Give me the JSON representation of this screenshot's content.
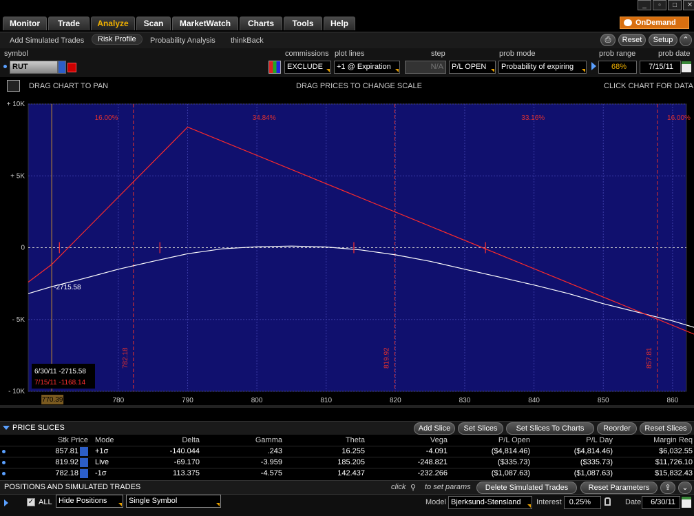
{
  "nav": {
    "tabs": [
      "Monitor",
      "Trade",
      "Analyze",
      "Scan",
      "MarketWatch",
      "Charts",
      "Tools",
      "Help"
    ],
    "active_tab": "Analyze",
    "ondemand_label": "OnDemand"
  },
  "subnav": {
    "items": [
      "Add Simulated Trades",
      "Risk Profile",
      "Probability Analysis",
      "thinkBack"
    ],
    "active": "Risk Profile",
    "reset_label": "Reset",
    "setup_label": "Setup"
  },
  "params": {
    "symbol_label": "symbol",
    "symbol_value": "RUT",
    "commissions_label": "commissions",
    "commissions_value": "EXCLUDE",
    "plotlines_label": "plot lines",
    "plotlines_value": "+1 @ Expiration",
    "step_label": "step",
    "step_value": "N/A",
    "pl_value": "P/L OPEN",
    "probmode_label": "prob mode",
    "probmode_value": "Probability of expiring",
    "probrange_label": "prob range",
    "probrange_value": "68%",
    "probdate_label": "prob date",
    "probdate_value": "7/15/11"
  },
  "chart_header": {
    "left": "DRAG CHART TO PAN",
    "center": "DRAG PRICES TO CHANGE SCALE",
    "right": "CLICK CHART FOR DATA"
  },
  "chart_data": {
    "type": "line",
    "xlim": [
      767,
      862
    ],
    "ylim": [
      -10000,
      10000
    ],
    "x_ticks": [
      780,
      790,
      800,
      810,
      820,
      830,
      840,
      850,
      860
    ],
    "y_ticks": [
      {
        "value": 10000,
        "label": "+ 10K"
      },
      {
        "value": 5000,
        "label": "+ 5K"
      },
      {
        "value": 0,
        "label": "0"
      },
      {
        "value": -5000,
        "label": "- 5K"
      },
      {
        "value": -10000,
        "label": "- 10K"
      }
    ],
    "current_price_label": "770.39",
    "current_price": 770.39,
    "grid": true,
    "series": [
      {
        "name": "6/30/11",
        "color": "#ffffff",
        "points": [
          [
            767,
            -3200
          ],
          [
            770.39,
            -2715.58
          ],
          [
            775,
            -2150
          ],
          [
            780,
            -1500
          ],
          [
            785,
            -950
          ],
          [
            790,
            -420
          ],
          [
            795,
            -80
          ],
          [
            800,
            60
          ],
          [
            805,
            110
          ],
          [
            810,
            50
          ],
          [
            815,
            -160
          ],
          [
            820,
            -500
          ],
          [
            825,
            -950
          ],
          [
            830,
            -1500
          ],
          [
            835,
            -2050
          ],
          [
            840,
            -2600
          ],
          [
            845,
            -3200
          ],
          [
            850,
            -3900
          ],
          [
            855,
            -4500
          ],
          [
            860,
            -5100
          ],
          [
            863.5,
            -5600
          ]
        ]
      },
      {
        "name": "7/15/11",
        "color": "#ff2a2a",
        "points": [
          [
            767,
            -2400
          ],
          [
            770.39,
            -1168.14
          ],
          [
            790,
            8400
          ],
          [
            863.5,
            -6100
          ]
        ]
      }
    ],
    "slice_lines": [
      782.18,
      819.92,
      857.81
    ],
    "slice_labels": [
      "782.18",
      "819.92",
      "857.81"
    ],
    "breakeven_markers": [
      [
        771.5,
        0
      ],
      [
        786,
        0
      ],
      [
        814,
        0
      ],
      [
        833,
        0
      ]
    ],
    "region_labels": [
      "16.00%",
      "34.84%",
      "33.16%",
      "16.00%"
    ],
    "annotation": "-2715.58",
    "readout": [
      {
        "date": "6/30/11",
        "value": "-2715.58",
        "color": "#ffffff"
      },
      {
        "date": "7/15/11",
        "value": "-1168.14",
        "color": "#ff3030"
      }
    ]
  },
  "price_slices": {
    "title": "PRICE SLICES",
    "buttons": [
      "Add Slice",
      "Set Slices",
      "Set Slices To Charts",
      "Reorder",
      "Reset Slices"
    ],
    "columns": [
      "Stk Price",
      "Mode",
      "Delta",
      "Gamma",
      "Theta",
      "Vega",
      "P/L Open",
      "P/L Day",
      "Margin Req"
    ],
    "rows": [
      [
        "857.81",
        "+1σ",
        "-140.044",
        ".243",
        "16.255",
        "-4.091",
        "($4,814.46)",
        "($4,814.46)",
        "$6,032.55"
      ],
      [
        "819.92",
        "Live",
        "-69.170",
        "-3.959",
        "185.205",
        "-248.821",
        "($335.73)",
        "($335.73)",
        "$11,726.10"
      ],
      [
        "782.18",
        "-1σ",
        "113.375",
        "-4.575",
        "142.437",
        "-232.266",
        "($1,087.63)",
        "($1,087.63)",
        "$15,832.43"
      ]
    ]
  },
  "positions": {
    "title": "POSITIONS AND SIMULATED TRADES",
    "click_text": "click",
    "set_params_text": "to set params",
    "delete_label": "Delete Simulated Trades",
    "reset_params_label": "Reset Parameters"
  },
  "bottom": {
    "all_label": "ALL",
    "hide_positions": "Hide Positions",
    "single_symbol": "Single Symbol",
    "model_label": "Model",
    "model_value": "Bjerksund-Stensland",
    "interest_label": "Interest",
    "interest_value": "0.25%",
    "date_label": "Date",
    "date_value": "6/30/11"
  },
  "colors": {
    "chart_bg": "#10106e",
    "red_line": "#ff2a2a",
    "accent": "#f0b000"
  }
}
